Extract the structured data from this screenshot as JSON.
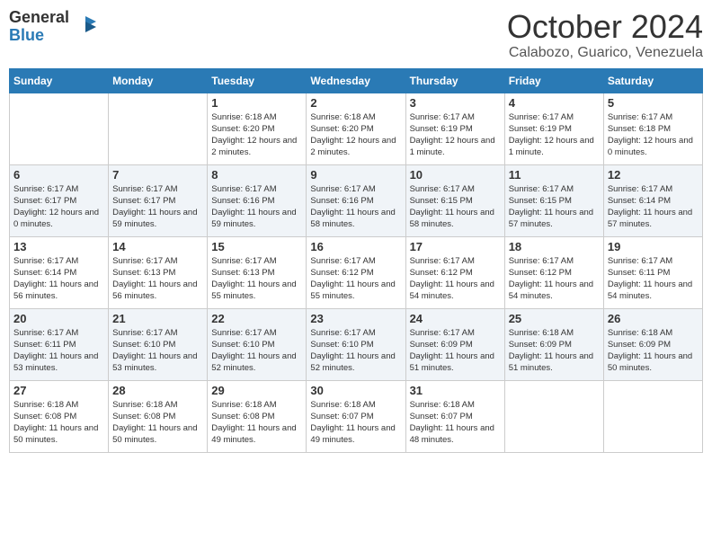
{
  "logo": {
    "general": "General",
    "blue": "Blue"
  },
  "header": {
    "month": "October 2024",
    "location": "Calabozo, Guarico, Venezuela"
  },
  "days_of_week": [
    "Sunday",
    "Monday",
    "Tuesday",
    "Wednesday",
    "Thursday",
    "Friday",
    "Saturday"
  ],
  "weeks": [
    [
      {
        "num": "",
        "info": ""
      },
      {
        "num": "",
        "info": ""
      },
      {
        "num": "1",
        "info": "Sunrise: 6:18 AM\nSunset: 6:20 PM\nDaylight: 12 hours and 2 minutes."
      },
      {
        "num": "2",
        "info": "Sunrise: 6:18 AM\nSunset: 6:20 PM\nDaylight: 12 hours and 2 minutes."
      },
      {
        "num": "3",
        "info": "Sunrise: 6:17 AM\nSunset: 6:19 PM\nDaylight: 12 hours and 1 minute."
      },
      {
        "num": "4",
        "info": "Sunrise: 6:17 AM\nSunset: 6:19 PM\nDaylight: 12 hours and 1 minute."
      },
      {
        "num": "5",
        "info": "Sunrise: 6:17 AM\nSunset: 6:18 PM\nDaylight: 12 hours and 0 minutes."
      }
    ],
    [
      {
        "num": "6",
        "info": "Sunrise: 6:17 AM\nSunset: 6:17 PM\nDaylight: 12 hours and 0 minutes."
      },
      {
        "num": "7",
        "info": "Sunrise: 6:17 AM\nSunset: 6:17 PM\nDaylight: 11 hours and 59 minutes."
      },
      {
        "num": "8",
        "info": "Sunrise: 6:17 AM\nSunset: 6:16 PM\nDaylight: 11 hours and 59 minutes."
      },
      {
        "num": "9",
        "info": "Sunrise: 6:17 AM\nSunset: 6:16 PM\nDaylight: 11 hours and 58 minutes."
      },
      {
        "num": "10",
        "info": "Sunrise: 6:17 AM\nSunset: 6:15 PM\nDaylight: 11 hours and 58 minutes."
      },
      {
        "num": "11",
        "info": "Sunrise: 6:17 AM\nSunset: 6:15 PM\nDaylight: 11 hours and 57 minutes."
      },
      {
        "num": "12",
        "info": "Sunrise: 6:17 AM\nSunset: 6:14 PM\nDaylight: 11 hours and 57 minutes."
      }
    ],
    [
      {
        "num": "13",
        "info": "Sunrise: 6:17 AM\nSunset: 6:14 PM\nDaylight: 11 hours and 56 minutes."
      },
      {
        "num": "14",
        "info": "Sunrise: 6:17 AM\nSunset: 6:13 PM\nDaylight: 11 hours and 56 minutes."
      },
      {
        "num": "15",
        "info": "Sunrise: 6:17 AM\nSunset: 6:13 PM\nDaylight: 11 hours and 55 minutes."
      },
      {
        "num": "16",
        "info": "Sunrise: 6:17 AM\nSunset: 6:12 PM\nDaylight: 11 hours and 55 minutes."
      },
      {
        "num": "17",
        "info": "Sunrise: 6:17 AM\nSunset: 6:12 PM\nDaylight: 11 hours and 54 minutes."
      },
      {
        "num": "18",
        "info": "Sunrise: 6:17 AM\nSunset: 6:12 PM\nDaylight: 11 hours and 54 minutes."
      },
      {
        "num": "19",
        "info": "Sunrise: 6:17 AM\nSunset: 6:11 PM\nDaylight: 11 hours and 54 minutes."
      }
    ],
    [
      {
        "num": "20",
        "info": "Sunrise: 6:17 AM\nSunset: 6:11 PM\nDaylight: 11 hours and 53 minutes."
      },
      {
        "num": "21",
        "info": "Sunrise: 6:17 AM\nSunset: 6:10 PM\nDaylight: 11 hours and 53 minutes."
      },
      {
        "num": "22",
        "info": "Sunrise: 6:17 AM\nSunset: 6:10 PM\nDaylight: 11 hours and 52 minutes."
      },
      {
        "num": "23",
        "info": "Sunrise: 6:17 AM\nSunset: 6:10 PM\nDaylight: 11 hours and 52 minutes."
      },
      {
        "num": "24",
        "info": "Sunrise: 6:17 AM\nSunset: 6:09 PM\nDaylight: 11 hours and 51 minutes."
      },
      {
        "num": "25",
        "info": "Sunrise: 6:18 AM\nSunset: 6:09 PM\nDaylight: 11 hours and 51 minutes."
      },
      {
        "num": "26",
        "info": "Sunrise: 6:18 AM\nSunset: 6:09 PM\nDaylight: 11 hours and 50 minutes."
      }
    ],
    [
      {
        "num": "27",
        "info": "Sunrise: 6:18 AM\nSunset: 6:08 PM\nDaylight: 11 hours and 50 minutes."
      },
      {
        "num": "28",
        "info": "Sunrise: 6:18 AM\nSunset: 6:08 PM\nDaylight: 11 hours and 50 minutes."
      },
      {
        "num": "29",
        "info": "Sunrise: 6:18 AM\nSunset: 6:08 PM\nDaylight: 11 hours and 49 minutes."
      },
      {
        "num": "30",
        "info": "Sunrise: 6:18 AM\nSunset: 6:07 PM\nDaylight: 11 hours and 49 minutes."
      },
      {
        "num": "31",
        "info": "Sunrise: 6:18 AM\nSunset: 6:07 PM\nDaylight: 11 hours and 48 minutes."
      },
      {
        "num": "",
        "info": ""
      },
      {
        "num": "",
        "info": ""
      }
    ]
  ]
}
